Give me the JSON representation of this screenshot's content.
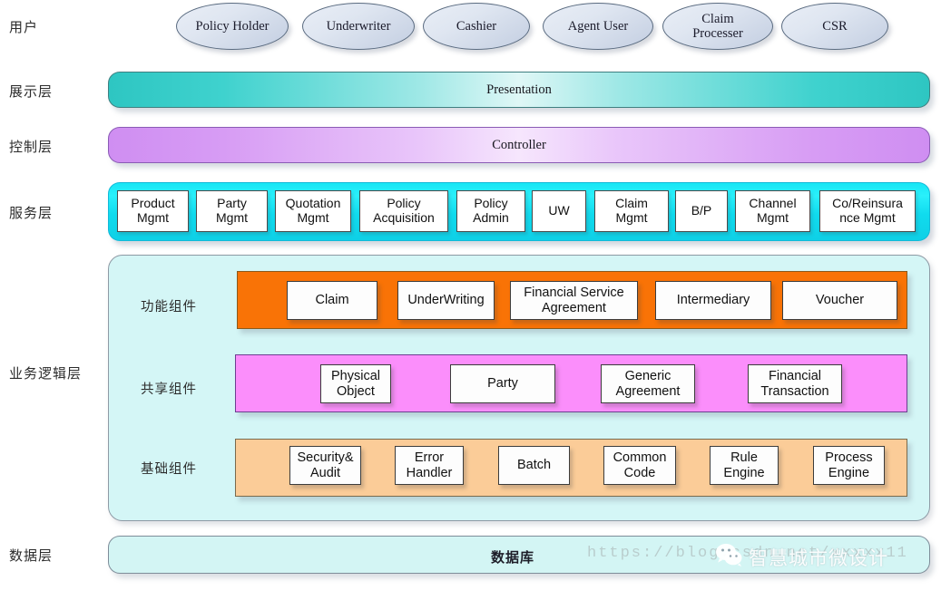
{
  "layer_labels": {
    "user": "用户",
    "presentation": "展示层",
    "controller": "控制层",
    "service": "服务层",
    "business": "业务逻辑层",
    "data": "数据层"
  },
  "actors": [
    {
      "label": "Policy Holder"
    },
    {
      "label": "Underwriter"
    },
    {
      "label": "Cashier"
    },
    {
      "label": "Agent User"
    },
    {
      "label": "Claim\nProcesser"
    },
    {
      "label": "CSR"
    }
  ],
  "bars": {
    "presentation": "Presentation",
    "controller": "Controller"
  },
  "service_layer": {
    "boxes": [
      {
        "label": "Product\nMgmt"
      },
      {
        "label": "Party\nMgmt"
      },
      {
        "label": "Quotation\nMgmt"
      },
      {
        "label": "Policy\nAcquisition"
      },
      {
        "label": "Policy\nAdmin"
      },
      {
        "label": "UW"
      },
      {
        "label": "Claim\nMgmt"
      },
      {
        "label": "B/P"
      },
      {
        "label": "Channel\nMgmt"
      },
      {
        "label": "Co/Reinsura\nnce Mgmt"
      }
    ]
  },
  "business_layer": {
    "rows": [
      {
        "label": "功能组件",
        "band_color": "#f97306",
        "boxes": [
          {
            "label": "Claim"
          },
          {
            "label": "UnderWriting"
          },
          {
            "label": "Financial  Service\nAgreement"
          },
          {
            "label": "Intermediary"
          },
          {
            "label": "Voucher"
          }
        ]
      },
      {
        "label": "共享组件",
        "band_color": "#fb8efb",
        "boxes": [
          {
            "label": "Physical\nObject"
          },
          {
            "label": "Party"
          },
          {
            "label": "Generic\nAgreement"
          },
          {
            "label": "Financial\nTransaction"
          }
        ]
      },
      {
        "label": "基础组件",
        "band_color": "#fbcc98",
        "boxes": [
          {
            "label": "Security&\nAudit"
          },
          {
            "label": "Error\nHandler"
          },
          {
            "label": "Batch"
          },
          {
            "label": "Common\nCode"
          },
          {
            "label": "Rule\nEngine"
          },
          {
            "label": "Process\nEngine"
          }
        ]
      }
    ]
  },
  "data_layer": {
    "title": "数据库"
  },
  "watermark": {
    "url": "https://blog.csdn.net/xxxxx11",
    "brand": "智慧城市微设计"
  },
  "colors": {
    "presentation_accent": "#2ec6c2",
    "controller_accent": "#cf8ef2",
    "service_accent": "#17e6f5",
    "functional_accent": "#f97306",
    "shared_accent": "#fb8efb",
    "foundation_accent": "#fbcc98",
    "container_bg": "#d4f6f6",
    "data_bg": "#d3f5f4"
  }
}
